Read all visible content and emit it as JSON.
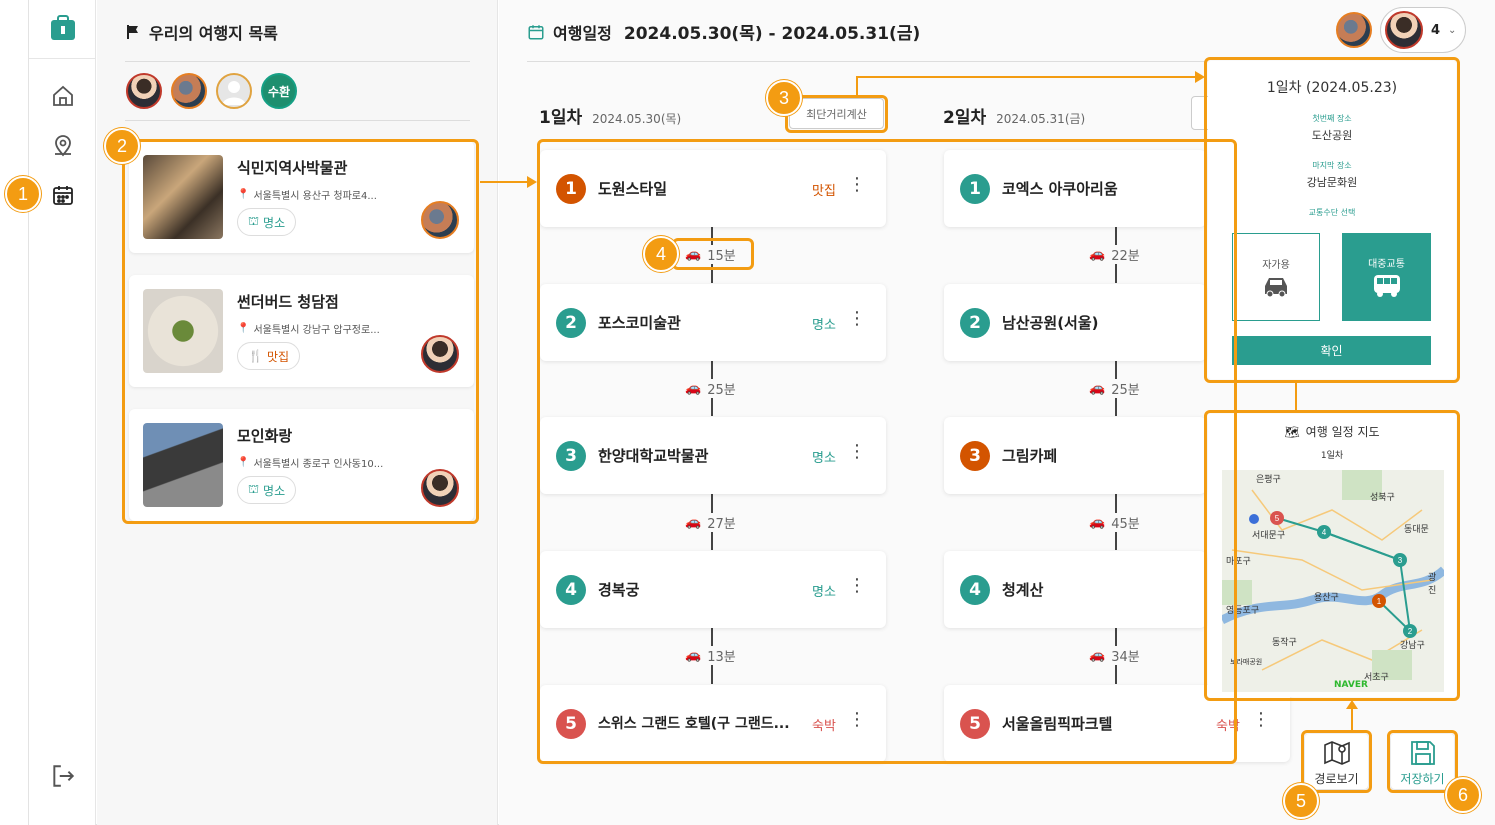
{
  "left_rail": {
    "items": [
      "logo-icon",
      "home-icon",
      "map-pin-icon",
      "calendar-icon",
      "logout-icon"
    ]
  },
  "sidebar": {
    "title": "우리의 여행지 목록",
    "members": [
      {
        "label": ""
      },
      {
        "label": ""
      },
      {
        "label": ""
      },
      {
        "label": "수환"
      }
    ],
    "places": [
      {
        "name": "식민지역사박물관",
        "address": "서울특별시 용산구 청파로4...",
        "tag": "명소",
        "tag_icon": "landmark-icon"
      },
      {
        "name": "썬더버드 청담점",
        "address": "서울특별시 강남구 압구정로...",
        "tag": "맛집",
        "tag_icon": "utensils-icon"
      },
      {
        "name": "모인화랑",
        "address": "서울특별시 종로구 인사동10...",
        "tag": "명소",
        "tag_icon": "landmark-icon"
      }
    ]
  },
  "header": {
    "title": "여행일정",
    "date_range": "2024.05.30(목) - 2024.05.31(금)",
    "member_count": "4"
  },
  "schedule": {
    "shortest_path_button": "최단거리계산",
    "days": [
      {
        "label": "1일차",
        "date": "2024.05.30(목)",
        "stops": [
          {
            "num": "1",
            "name": "도원스타일",
            "tag": "맛집",
            "color": "#d35400"
          },
          {
            "num": "2",
            "name": "포스코미술관",
            "tag": "명소",
            "color": "#2a9d8f"
          },
          {
            "num": "3",
            "name": "한양대학교박물관",
            "tag": "명소",
            "color": "#2a9d8f"
          },
          {
            "num": "4",
            "name": "경복궁",
            "tag": "명소",
            "color": "#2a9d8f"
          },
          {
            "num": "5",
            "name": "스위스 그랜드 호텔(구 그랜드...",
            "tag": "숙박",
            "color": "#d9534f"
          }
        ],
        "travel": [
          "15분",
          "25분",
          "27분",
          "13분"
        ]
      },
      {
        "label": "2일차",
        "date": "2024.05.31(금)",
        "stops": [
          {
            "num": "1",
            "name": "코엑스 아쿠아리움",
            "tag": "",
            "color": "#2a9d8f"
          },
          {
            "num": "2",
            "name": "남산공원(서울)",
            "tag": "",
            "color": "#2a9d8f"
          },
          {
            "num": "3",
            "name": "그림카페",
            "tag": "",
            "color": "#d35400"
          },
          {
            "num": "4",
            "name": "청계산",
            "tag": "",
            "color": "#2a9d8f"
          },
          {
            "num": "5",
            "name": "서울올림픽파크텔",
            "tag": "숙박",
            "color": "#d9534f"
          }
        ],
        "travel": [
          "22분",
          "25분",
          "45분",
          "34분"
        ]
      }
    ]
  },
  "popup": {
    "title": "1일차 (2024.05.23)",
    "first_label": "첫번째 장소",
    "first_value": "도산공원",
    "last_label": "마지막 장소",
    "last_value": "강남문화원",
    "transport_label": "교통수단 선택",
    "car_label": "자가용",
    "transit_label": "대중교통",
    "confirm": "확인"
  },
  "map_panel": {
    "title": "여행 일정 지도",
    "day": "1일차",
    "labels": [
      "은평구",
      "성북구",
      "서대문구",
      "동대문",
      "마포구",
      "광진",
      "용산구",
      "영등포구",
      "동작구",
      "강남구",
      "서초구",
      "보라매공원",
      "NAVER"
    ]
  },
  "actions": {
    "route_view": "경로보기",
    "save": "저장하기"
  },
  "annotations": [
    "1",
    "2",
    "3",
    "4",
    "5",
    "6"
  ],
  "colors": {
    "teal": "#2a9d8f",
    "orange_highlight": "#f39c12",
    "red_tag": "#d9534f"
  }
}
